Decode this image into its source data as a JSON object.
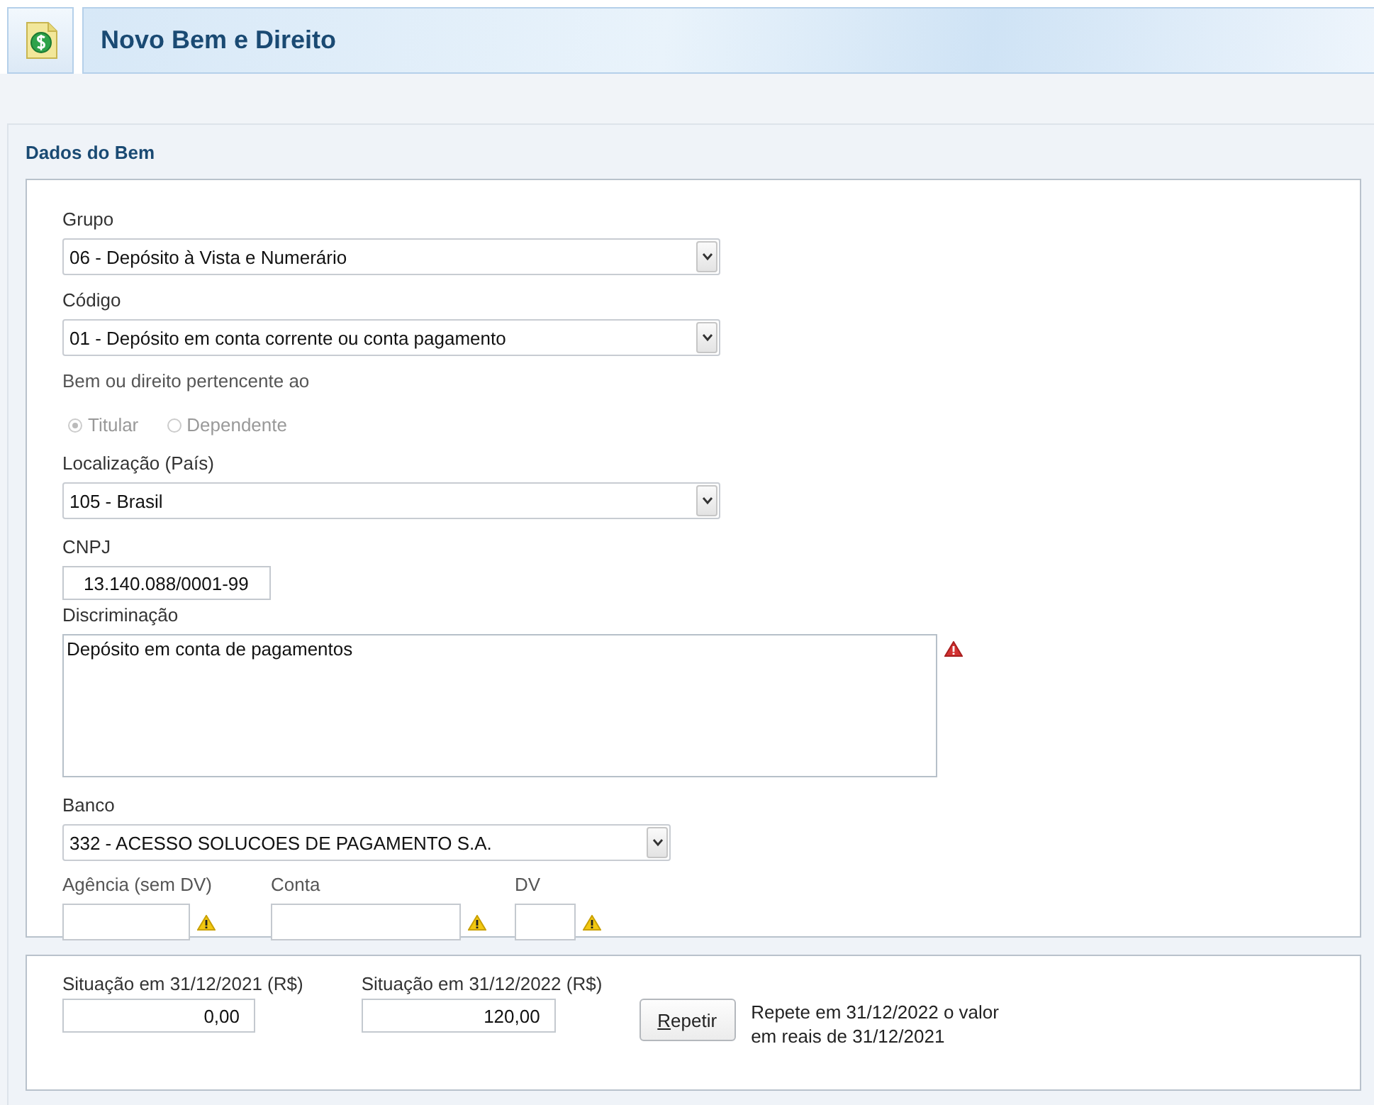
{
  "window": {
    "title": "Novo Bem e Direito"
  },
  "section": {
    "title": "Dados do Bem"
  },
  "grupo": {
    "label": "Grupo",
    "value": "06 - Depósito à Vista e Numerário"
  },
  "codigo": {
    "label": "Código",
    "value": "01 - Depósito em conta corrente ou conta pagamento"
  },
  "pertencente": {
    "label": "Bem ou direito pertencente ao",
    "disabled": true,
    "options": [
      {
        "label": "Titular",
        "selected": true
      },
      {
        "label": "Dependente",
        "selected": false
      }
    ]
  },
  "localizacao": {
    "label": "Localização (País)",
    "value": "105 - Brasil"
  },
  "cnpj": {
    "label": "CNPJ",
    "value": "13.140.088/0001-99"
  },
  "discriminacao": {
    "label": "Discriminação",
    "value": "Depósito em conta de pagamentos",
    "error": true
  },
  "banco": {
    "label": "Banco",
    "value": "332 - ACESSO SOLUCOES DE PAGAMENTO S.A."
  },
  "conta_fields": [
    {
      "kind": "agencia",
      "label": "Agência (sem DV)",
      "warning": true
    },
    {
      "kind": "conta",
      "label": "Conta",
      "warning": true
    },
    {
      "kind": "dv",
      "label": "DV",
      "warning": true
    }
  ],
  "situacao": [
    {
      "label": "Situação em 31/12/2021 (R$)",
      "value": "0,00"
    },
    {
      "label": "Situação em 31/12/2022 (R$)",
      "value": "120,00"
    }
  ],
  "repeat_button": {
    "label": "Repetir",
    "first_letter_underlined": true
  },
  "repeat_note": "Repete em 31/12/2022 o valor em reais de 31/12/2021"
}
